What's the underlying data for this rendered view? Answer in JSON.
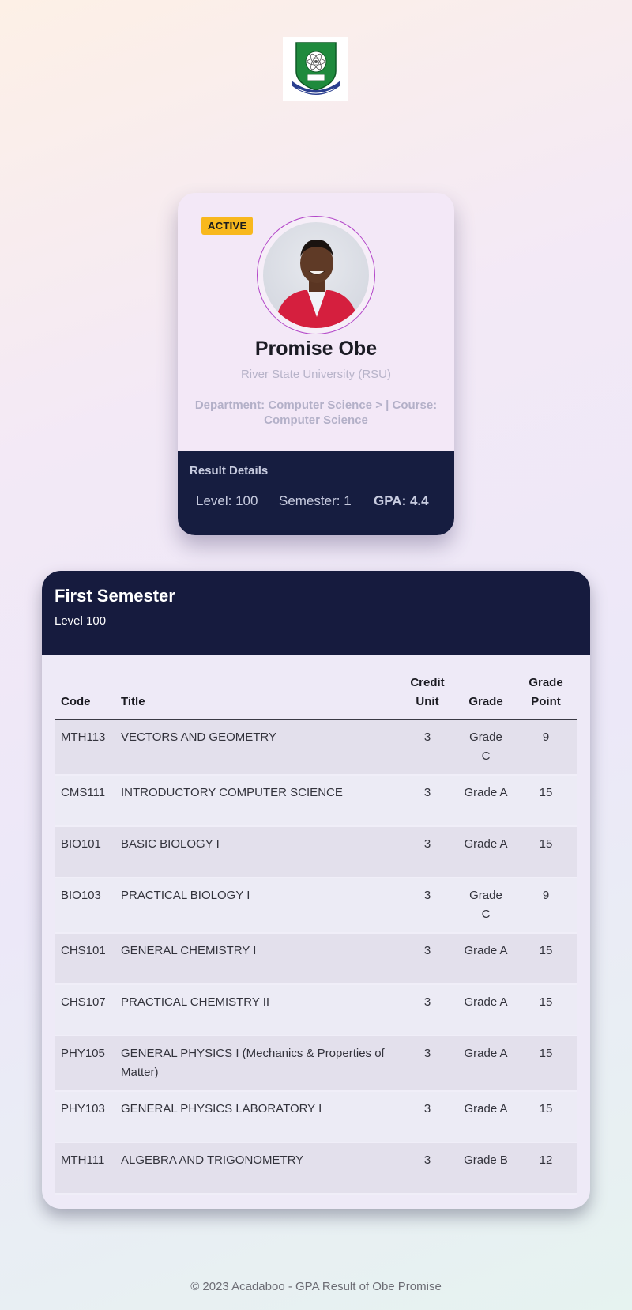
{
  "logo": {
    "alt": "River State University crest"
  },
  "profile": {
    "status_badge": "ACTIVE",
    "name": "Promise Obe",
    "university": "River State University (RSU)",
    "department_line": "Department: Computer Science > | Course: Computer Science"
  },
  "result_details": {
    "title": "Result Details",
    "level": "Level: 100",
    "semester": "Semester: 1",
    "gpa": "GPA: 4.4"
  },
  "semester": {
    "title": "First Semester",
    "level": "Level 100",
    "columns": {
      "code": "Code",
      "title": "Title",
      "credit_unit": "Credit Unit",
      "grade": "Grade",
      "grade_point": "Grade Point"
    },
    "rows": [
      {
        "code": "MTH113",
        "title": "VECTORS AND GEOMETRY",
        "credit_unit": "3",
        "grade": "Grade C",
        "grade_point": "9"
      },
      {
        "code": "CMS111",
        "title": "INTRODUCTORY COMPUTER SCIENCE",
        "credit_unit": "3",
        "grade": "Grade A",
        "grade_point": "15"
      },
      {
        "code": "BIO101",
        "title": "BASIC BIOLOGY I",
        "credit_unit": "3",
        "grade": "Grade A",
        "grade_point": "15"
      },
      {
        "code": "BIO103",
        "title": "PRACTICAL BIOLOGY I",
        "credit_unit": "3",
        "grade": "Grade C",
        "grade_point": "9"
      },
      {
        "code": "CHS101",
        "title": "GENERAL CHEMISTRY I",
        "credit_unit": "3",
        "grade": "Grade A",
        "grade_point": "15"
      },
      {
        "code": "CHS107",
        "title": "PRACTICAL CHEMISTRY II",
        "credit_unit": "3",
        "grade": "Grade A",
        "grade_point": "15"
      },
      {
        "code": "PHY105",
        "title": "GENERAL PHYSICS I (Mechanics & Properties of Matter)",
        "credit_unit": "3",
        "grade": "Grade A",
        "grade_point": "15"
      },
      {
        "code": "PHY103",
        "title": "GENERAL PHYSICS LABORATORY I",
        "credit_unit": "3",
        "grade": "Grade A",
        "grade_point": "15"
      },
      {
        "code": "MTH111",
        "title": "ALGEBRA AND TRIGONOMETRY",
        "credit_unit": "3",
        "grade": "Grade B",
        "grade_point": "12"
      }
    ]
  },
  "footer": {
    "text": "© 2023 Acadaboo - GPA Result of Obe Promise"
  },
  "colors": {
    "badge": "#f8b81d",
    "dark_panel": "#161d40",
    "avatar_ring": "#b245c8",
    "crest_green": "#1f8a3d",
    "crest_blue": "#2b3f8f"
  }
}
